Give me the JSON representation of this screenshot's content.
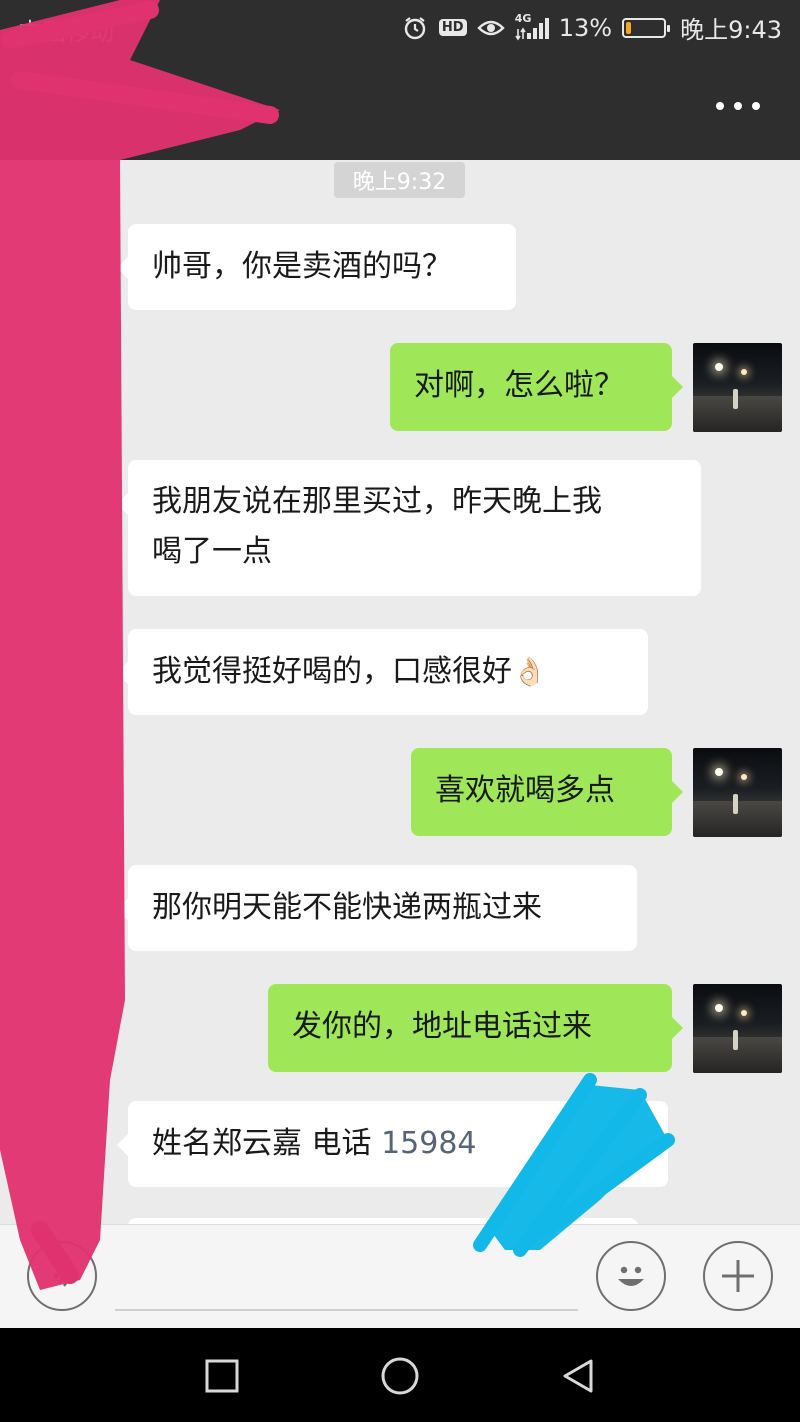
{
  "status_bar": {
    "carrier": "中国移动",
    "network": "4G",
    "battery_percent": "13%",
    "battery_level": 0.13,
    "time": "晚上9:43",
    "icons": [
      "alarm-icon",
      "hd-icon",
      "eye-icon",
      "signal-icon",
      "battery-icon"
    ]
  },
  "header": {
    "more_icon": "more-icon"
  },
  "chat": {
    "timestamp": "晚上9:32",
    "messages": [
      {
        "side": "in",
        "text": "帅哥，你是卖酒的吗？"
      },
      {
        "side": "out",
        "text": "对啊，怎么啦？"
      },
      {
        "side": "in",
        "line1": "我朋友说在那里买过，昨天晚上我",
        "line2": "喝了一点"
      },
      {
        "side": "in",
        "text": "我觉得挺好喝的，口感很好",
        "emoji": "👌🏻"
      },
      {
        "side": "out",
        "text": "喜欢就喝多点"
      },
      {
        "side": "in",
        "text": "那你明天能不能快递两瓶过来"
      },
      {
        "side": "out",
        "text": "发你的，地址电话过来"
      },
      {
        "side": "in",
        "prefix": "姓名郑云嘉  电话 ",
        "phone": "15984"
      }
    ]
  },
  "input_bar": {
    "voice_icon": "voice-icon",
    "emoji_icon": "emoji-icon",
    "plus_icon": "plus-icon"
  },
  "nav_bar": {
    "icons": [
      "recents-icon",
      "home-icon",
      "back-icon"
    ]
  },
  "colors": {
    "dark_bar": "#2e2e2e",
    "chat_bg": "#ebebeb",
    "outgoing_bubble": "#9fe658",
    "incoming_bubble": "#ffffff",
    "battery_fill": "#f5a623",
    "redaction_pink": "#e0326e",
    "redaction_blue": "#12b8e8"
  }
}
